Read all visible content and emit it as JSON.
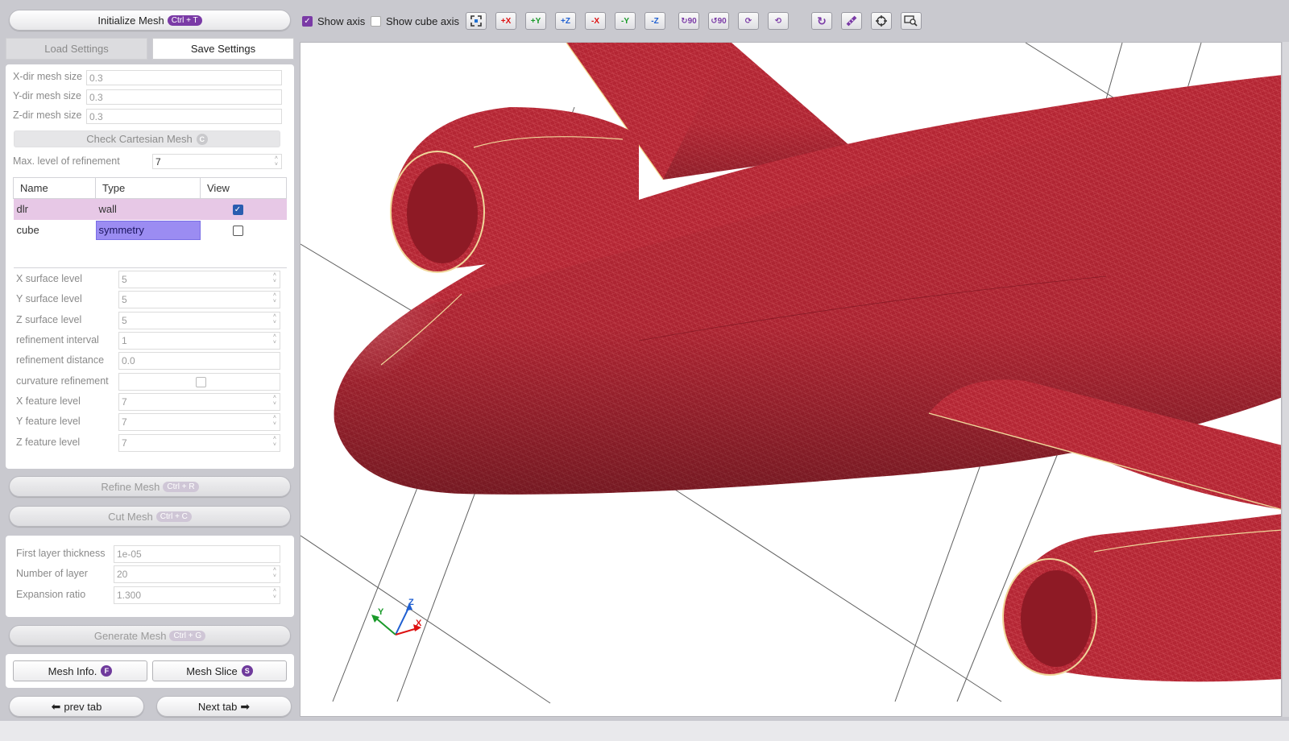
{
  "buttons": {
    "initialize_mesh": "Initialize Mesh",
    "initialize_shortcut": "Ctrl + T",
    "check_cartesian": "Check Cartesian Mesh",
    "check_shortcut": "C",
    "refine_mesh": "Refine Mesh",
    "refine_shortcut": "Ctrl + R",
    "cut_mesh": "Cut Mesh",
    "cut_shortcut": "Ctrl + C",
    "generate_mesh": "Generate Mesh",
    "generate_shortcut": "Ctrl + G",
    "mesh_info": "Mesh Info.",
    "mesh_info_shortcut": "F",
    "mesh_slice": "Mesh Slice",
    "mesh_slice_shortcut": "S",
    "prev_tab": "prev tab",
    "next_tab": "Next tab"
  },
  "tabs": {
    "load": "Load Settings",
    "save": "Save Settings"
  },
  "mesh_size": {
    "x_label": "X-dir mesh size",
    "x_value": "0.3",
    "y_label": "Y-dir mesh size",
    "y_value": "0.3",
    "z_label": "Z-dir mesh size",
    "z_value": "0.3"
  },
  "max_level": {
    "label": "Max. level of refinement",
    "value": "7"
  },
  "boundary_table": {
    "headers": [
      "Name",
      "Type",
      "View"
    ],
    "rows": [
      {
        "name": "dlr",
        "type": "wall",
        "view": true
      },
      {
        "name": "cube",
        "type": "symmetry",
        "view": false
      }
    ]
  },
  "refinement": {
    "x_surface_label": "X surface level",
    "x_surface": "5",
    "y_surface_label": "Y surface level",
    "y_surface": "5",
    "z_surface_label": "Z surface level",
    "z_surface": "5",
    "interval_label": "refinement interval",
    "interval": "1",
    "distance_label": "refinement distance",
    "distance": "0.0",
    "curvature_label": "curvature refinement",
    "x_feature_label": "X feature level",
    "x_feature": "7",
    "y_feature_label": "Y feature level",
    "y_feature": "7",
    "z_feature_label": "Z feature level",
    "z_feature": "7"
  },
  "layers": {
    "thickness_label": "First layer thickness",
    "thickness": "1e-05",
    "number_label": "Number of layer",
    "number": "20",
    "ratio_label": "Expansion ratio",
    "ratio": "1.300"
  },
  "toolbar": {
    "show_axis": "Show axis",
    "show_axis_checked": true,
    "show_cube_axis": "Show cube axis",
    "show_cube_axis_checked": false,
    "view_icons": [
      "fit-view-icon",
      "view-plus-x-icon",
      "view-plus-y-icon",
      "view-plus-z-icon",
      "view-minus-x-icon",
      "view-minus-y-icon",
      "view-minus-z-icon"
    ],
    "rotate_icons": [
      "rotate-90-cw-icon",
      "rotate-90-ccw-icon",
      "rotate-90-x-icon",
      "rotate-90-y-icon"
    ],
    "tool_icons": [
      "reset-view-icon",
      "measure-ruler-icon",
      "crosshair-icon",
      "zoom-window-icon"
    ]
  },
  "axis_triad": {
    "x": "X",
    "y": "Y",
    "z": "Z"
  },
  "colors": {
    "mesh_red": "#b32230",
    "accent_purple": "#7a3aa6",
    "row_highlight": "#e7c8e6",
    "selection": "#9b8cf2"
  }
}
